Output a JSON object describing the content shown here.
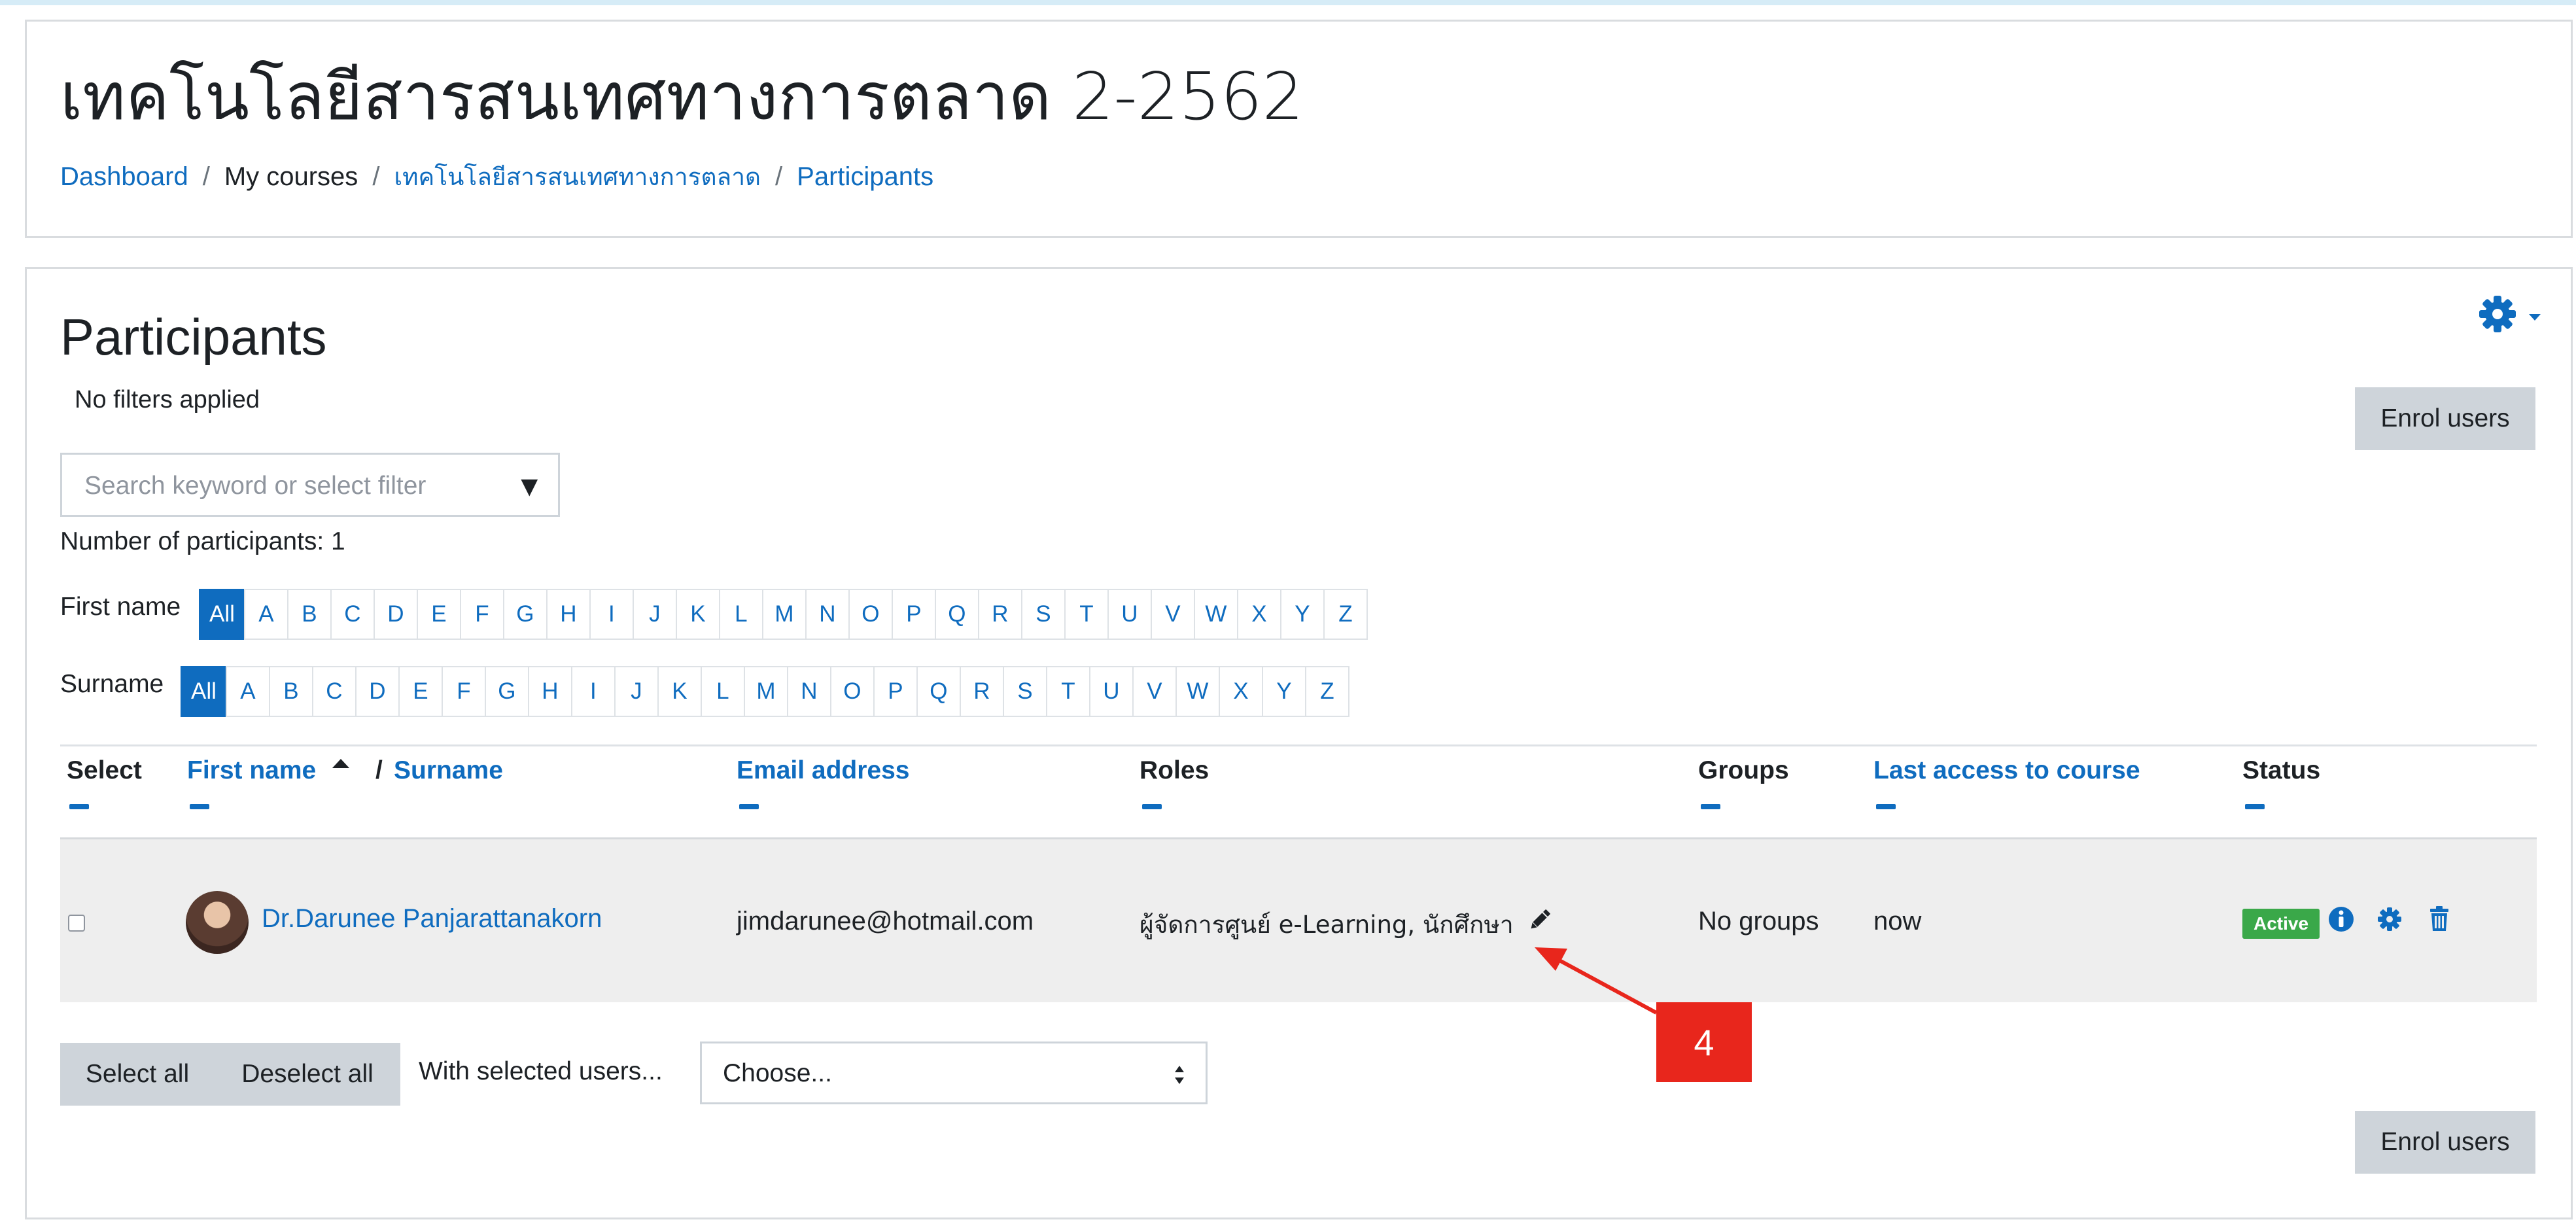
{
  "header": {
    "title": "เทคโนโลยีสารสนเทศทางการตลาด 2-2562",
    "breadcrumb": [
      "Dashboard",
      "My courses",
      "เทคโนโลยีสารสนเทศทางการตลาด",
      "Participants"
    ],
    "breadcrumb_separator": "/"
  },
  "main": {
    "heading": "Participants",
    "filters_status": "No filters applied",
    "enrol_label": "Enrol users",
    "search_placeholder": "Search keyword or select filter",
    "participants_count": "Number of participants: 1",
    "firstname_label": "First name",
    "surname_label": "Surname",
    "initials": [
      "All",
      "A",
      "B",
      "C",
      "D",
      "E",
      "F",
      "G",
      "H",
      "I",
      "J",
      "K",
      "L",
      "M",
      "N",
      "O",
      "P",
      "Q",
      "R",
      "S",
      "T",
      "U",
      "V",
      "W",
      "X",
      "Y",
      "Z"
    ],
    "columns": {
      "select": "Select",
      "first_name": "First name",
      "separator": "/",
      "surname": "Surname",
      "email": "Email address",
      "roles": "Roles",
      "groups": "Groups",
      "last_access": "Last access to course",
      "status": "Status"
    },
    "rows": [
      {
        "name": "Dr.Darunee Panjarattanakorn",
        "email": "jimdarunee@hotmail.com",
        "roles": "ผู้จัดการศูนย์ e-Learning, นักศึกษา",
        "groups": "No groups",
        "last_access": "now",
        "status": "Active"
      }
    ],
    "footer": {
      "select_all": "Select all",
      "deselect_all": "Deselect all",
      "with_selected": "With selected users...",
      "choose": "Choose..."
    }
  },
  "annotation": {
    "label": "4"
  },
  "icons": [
    "gear-icon",
    "caret-down-icon",
    "sort-up-icon",
    "pencil-icon",
    "info-icon",
    "cog-icon",
    "trash-icon"
  ],
  "colors": {
    "link": "#0f6cbf",
    "active_badge": "#3aa849",
    "annotation": "#e8261c",
    "button_grey": "#ced4da"
  }
}
